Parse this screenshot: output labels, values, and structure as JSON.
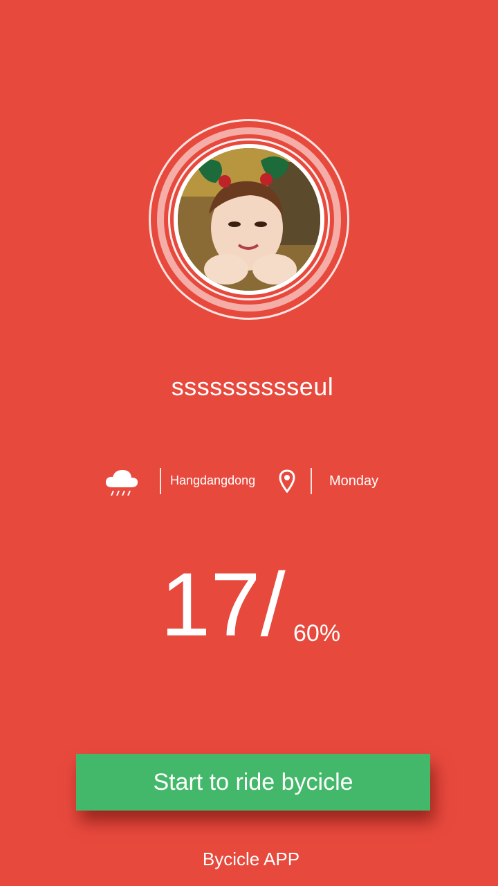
{
  "profile": {
    "username": "sssssssssseul",
    "avatar": "profile-photo"
  },
  "info": {
    "weather_icon": "rain-cloud-icon",
    "location": "Hangdangdong",
    "location_icon": "location-pin-icon",
    "day": "Monday"
  },
  "stats": {
    "value": "17/",
    "percent": "60%"
  },
  "actions": {
    "start_label": "Start to ride bycicle"
  },
  "footer": {
    "app_name": "Bycicle APP"
  },
  "colors": {
    "background": "#e8493d",
    "button": "#44b86a",
    "text": "#ffffff"
  }
}
